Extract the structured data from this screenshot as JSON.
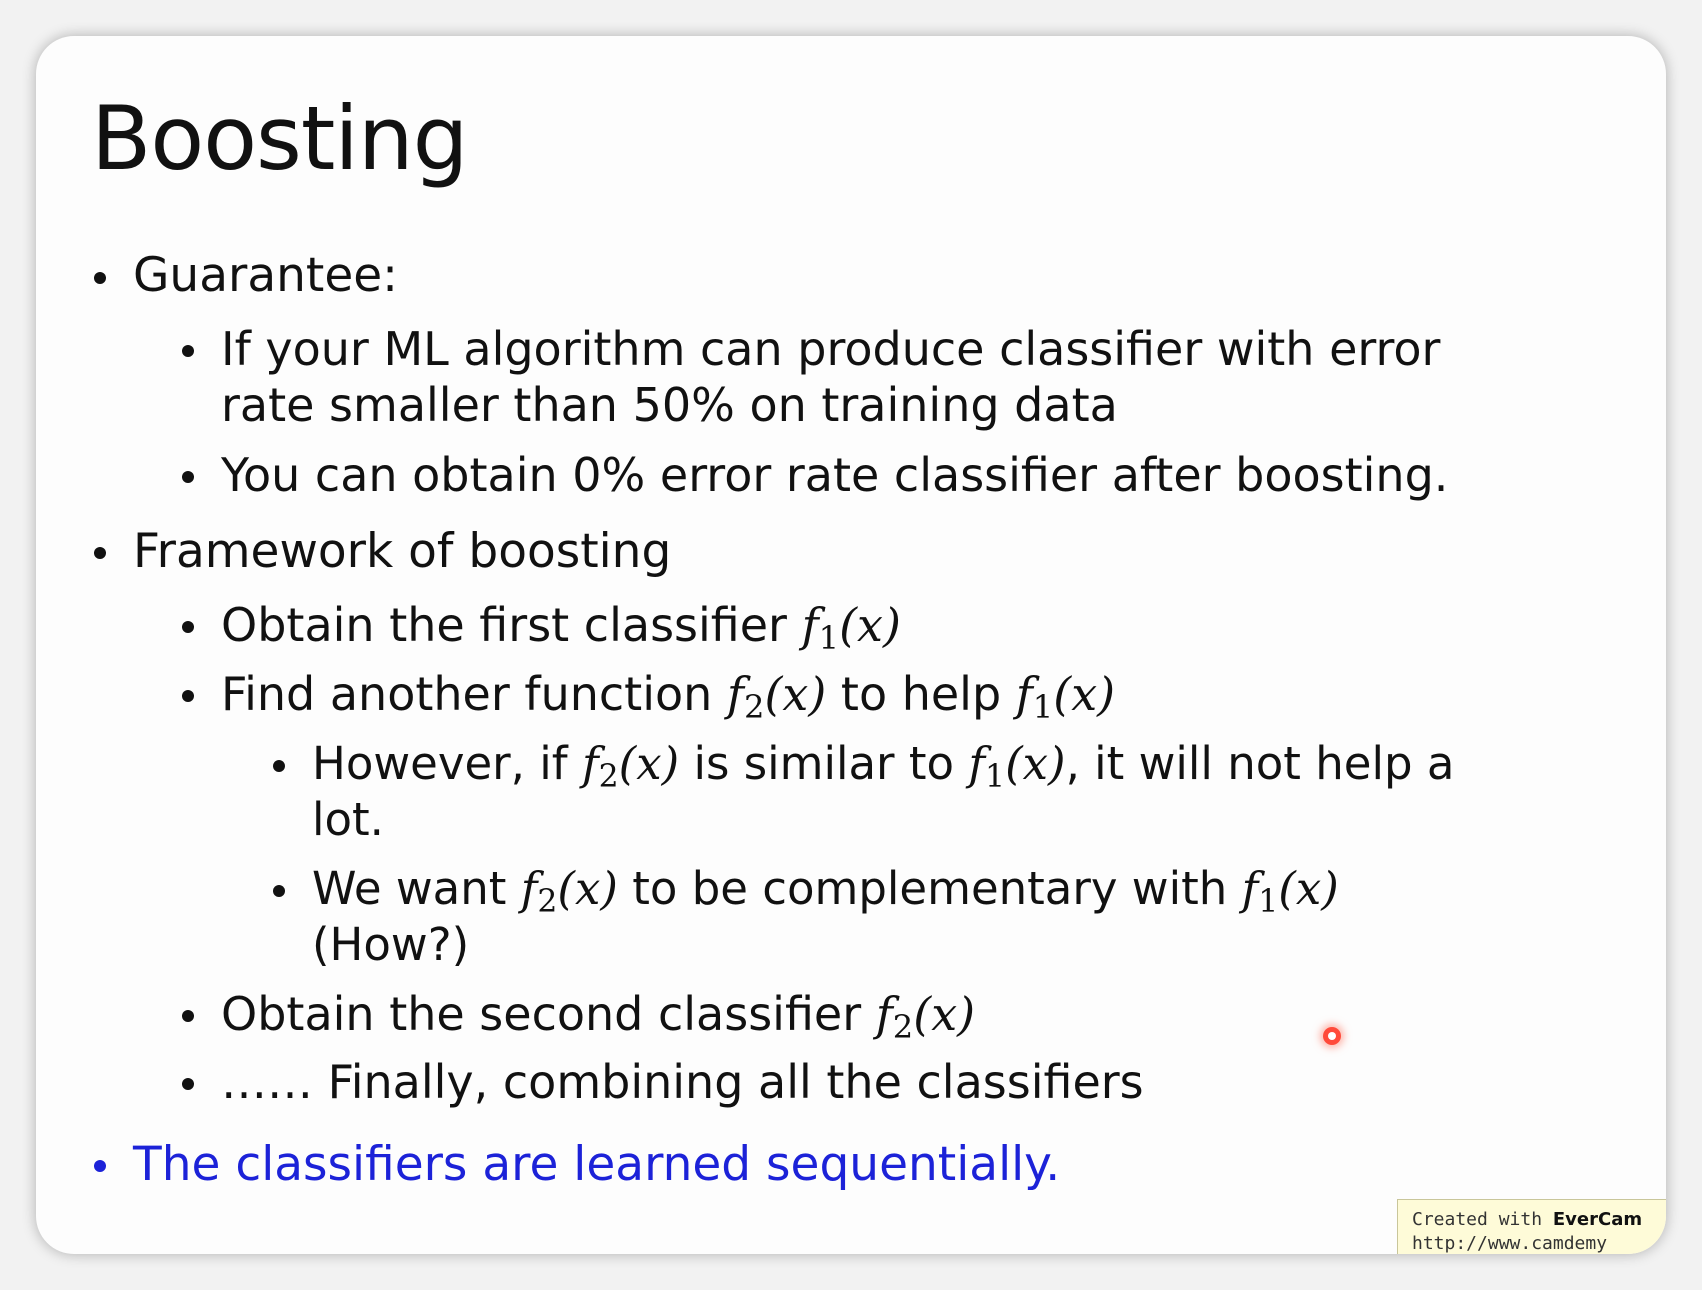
{
  "slide": {
    "title": "Boosting",
    "guarantee": {
      "label": "Guarantee:",
      "item1_line1": "If your ML algorithm can produce classifier with error",
      "item1_line2": "rate smaller than 50% on training data",
      "item2": "You can obtain 0% error rate classifier after boosting."
    },
    "framework": {
      "label": "Framework of boosting",
      "step1_text": "Obtain the first classifier ",
      "step2_text_a": "Find another function ",
      "step2_text_b": " to help ",
      "note1_a": "However, if ",
      "note1_b": " is similar to ",
      "note1_c": ", it will not help a",
      "note1_line2": "lot.",
      "note2_a": "We want ",
      "note2_b": " to be complementary with ",
      "note2_line2": "(How?)",
      "step3_text": "Obtain the second classifier ",
      "step4_text": "…… Finally, combining all the classifiers"
    },
    "conclusion": "The classifiers are learned sequentially.",
    "math": {
      "f_symbol": "f",
      "sub1": "1",
      "sub2": "2",
      "arg": "(x)"
    }
  },
  "watermark": {
    "created_prefix": "Created with ",
    "brand": "EverCam",
    "url": "http://www.camdemy"
  },
  "colors": {
    "text": "#111111",
    "accent_blue": "#1c22d8",
    "pointer": "#ff4a3a"
  }
}
